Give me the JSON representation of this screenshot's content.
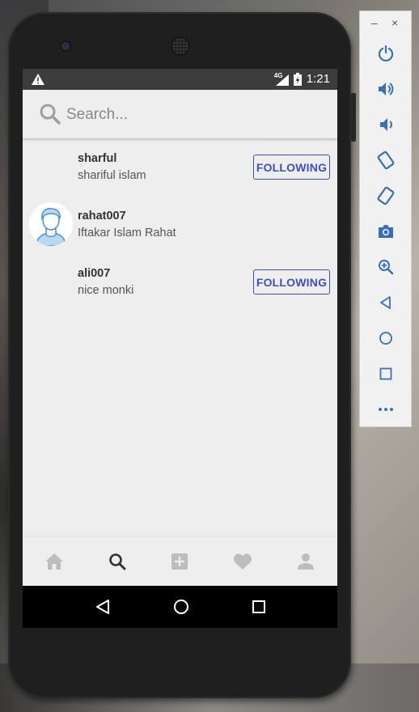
{
  "status": {
    "network": "4G",
    "time": "1:21"
  },
  "search": {
    "placeholder": "Search..."
  },
  "users": [
    {
      "username": "sharful",
      "fullname": "shariful islam",
      "button": "FOLLOWING"
    },
    {
      "username": "rahat007",
      "fullname": "Iftakar Islam Rahat"
    },
    {
      "username": "ali007",
      "fullname": "nice monki",
      "button": "FOLLOWING"
    }
  ],
  "tabs": [
    {
      "icon": "home-icon"
    },
    {
      "icon": "search-icon",
      "active": true
    },
    {
      "icon": "add-box-icon"
    },
    {
      "icon": "heart-icon"
    },
    {
      "icon": "person-icon"
    }
  ],
  "colors": {
    "accent": "#3f51b5",
    "status_bar": "#3c3c3c",
    "screen_bg": "#eeeeee"
  },
  "emulator": {
    "minimize": "–",
    "close": "×",
    "buttons": [
      "power-icon",
      "volume-up-icon",
      "volume-down-icon",
      "rotate-left-icon",
      "rotate-right-icon",
      "camera-icon",
      "zoom-icon",
      "back-icon",
      "home-icon",
      "overview-icon",
      "more-icon"
    ]
  }
}
